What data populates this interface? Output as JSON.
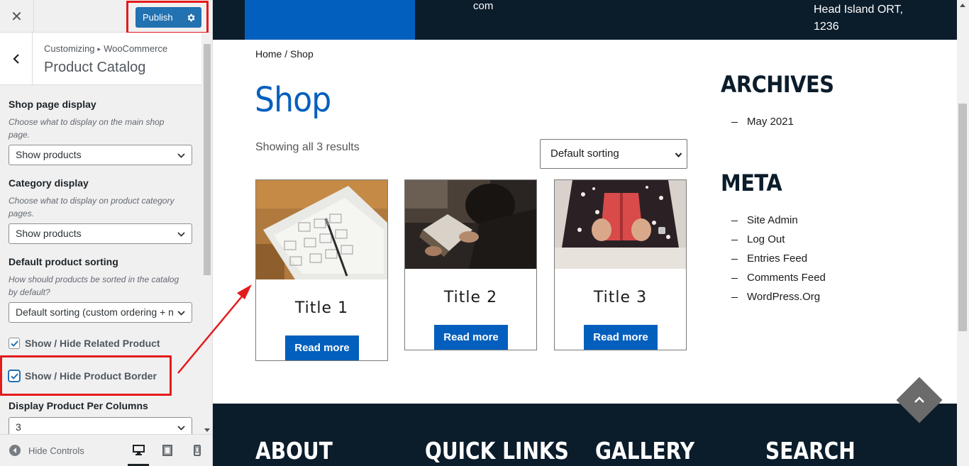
{
  "customizer": {
    "close_label": "✕",
    "publish_label": "Publish",
    "breadcrumb_root": "Customizing",
    "breadcrumb_section": "WooCommerce",
    "panel_title": "Product Catalog",
    "controls": {
      "shop_page_display": {
        "title": "Shop page display",
        "description": "Choose what to display on the main shop page.",
        "value": "Show products"
      },
      "category_display": {
        "title": "Category display",
        "description": "Choose what to display on product category pages.",
        "value": "Show products"
      },
      "default_sorting": {
        "title": "Default product sorting",
        "description": "How should products be sorted in the catalog by default?",
        "value": "Default sorting (custom ordering + n"
      },
      "related_product": {
        "label": "Show / Hide Related Product",
        "checked": true
      },
      "product_border": {
        "label": "Show / Hide Product Border",
        "checked": true
      },
      "per_columns": {
        "title": "Display Product Per Columns",
        "value": "3"
      }
    },
    "hide_controls_label": "Hide Controls",
    "devices": [
      "desktop-icon",
      "tablet-icon",
      "mobile-icon"
    ],
    "active_device": "desktop"
  },
  "preview": {
    "top_email": "com",
    "top_address": "Head Island ORT, 1236",
    "breadcrumb_home": "Home",
    "breadcrumb_sep": " / ",
    "breadcrumb_current": "Shop",
    "shop_title": "Shop",
    "result_count": "Showing all 3 results",
    "sort_value": "Default sorting",
    "products": [
      {
        "title": "Title 1",
        "button": "Read more"
      },
      {
        "title": "Title 2",
        "button": "Read more"
      },
      {
        "title": "Title 3",
        "button": "Read more"
      }
    ],
    "archives": {
      "title": "ARCHIVES",
      "items": [
        "May 2021"
      ]
    },
    "meta": {
      "title": "META",
      "items": [
        "Site Admin",
        "Log Out",
        "Entries Feed",
        "Comments Feed",
        "WordPress.Org"
      ]
    },
    "footer_headings": [
      "ABOUT",
      "QUICK LINKS",
      "GALLERY",
      "SEARCH"
    ]
  },
  "colors": {
    "accent": "#2271b1",
    "site_blue": "#035fbd",
    "site_dark": "#0b1c2b",
    "annotation_red": "#e41b1b"
  }
}
